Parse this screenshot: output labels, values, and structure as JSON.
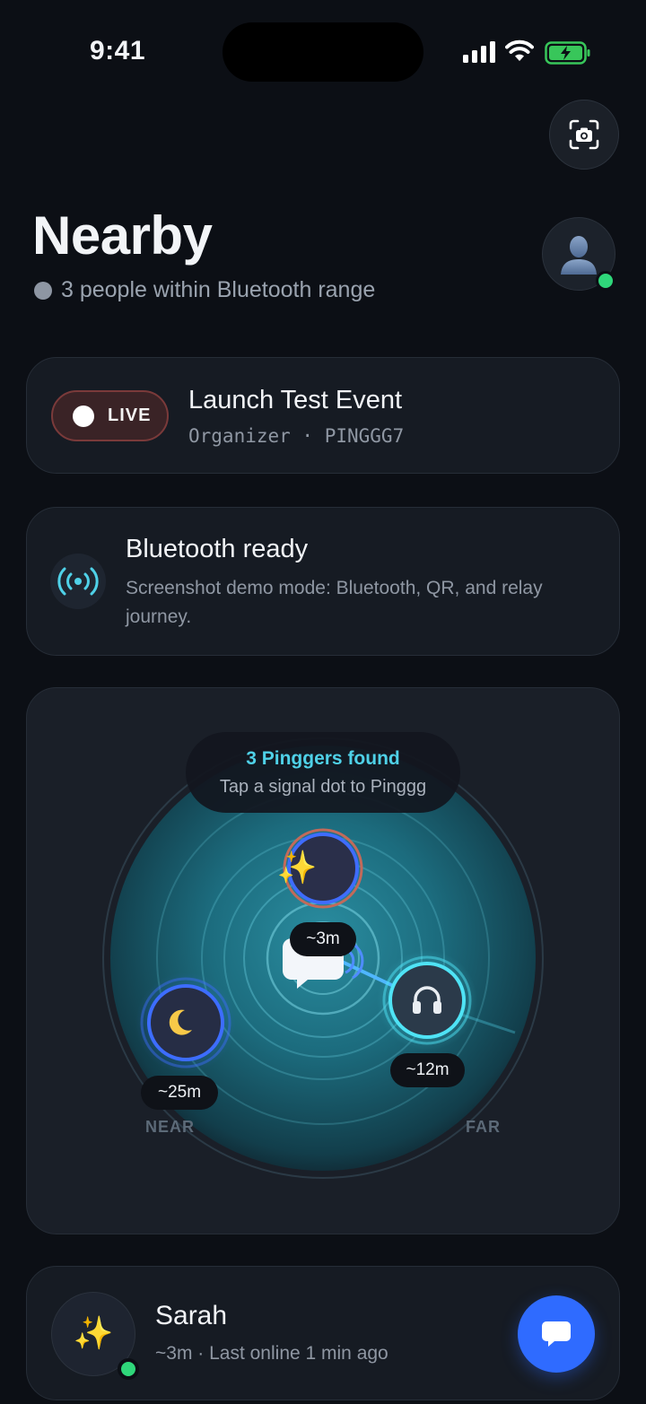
{
  "status_bar": {
    "time": "9:41"
  },
  "header": {
    "title": "Nearby",
    "subtitle": "3 people within Bluetooth range",
    "scan_icon": "camera-scan-icon",
    "avatar_icon": "person-silhouette-icon"
  },
  "event": {
    "live_label": "LIVE",
    "title": "Launch Test Event",
    "subtitle": "Organizer · PINGGG7"
  },
  "bluetooth": {
    "icon": "broadcast-signal-icon",
    "title": "Bluetooth ready",
    "description": "Screenshot demo mode: Bluetooth, QR, and relay journey."
  },
  "radar": {
    "found_title": "3 Pinggers found",
    "found_subtitle": "Tap a signal dot to Pinggg",
    "near_label": "NEAR",
    "far_label": "FAR",
    "center_icon": "chat-bubble-icon",
    "people": [
      {
        "icon": "sparkles-icon",
        "glyph": "✨",
        "distance": "~3m"
      },
      {
        "icon": "headphones-icon",
        "glyph": "🎧",
        "distance": "~12m"
      },
      {
        "icon": "crescent-moon-icon",
        "glyph": "🌙",
        "distance": "~25m"
      }
    ]
  },
  "nearby_list": [
    {
      "name": "Sarah",
      "glyph": "✨",
      "meta": "~3m · Last online 1 min ago",
      "online": true
    }
  ],
  "colors": {
    "background": "#0c0f15",
    "card": "#161b23",
    "accent_cyan": "#4fd1e8",
    "accent_blue": "#2f6bff",
    "online_green": "#2fd77a",
    "live_red": "#7a3a3a"
  }
}
